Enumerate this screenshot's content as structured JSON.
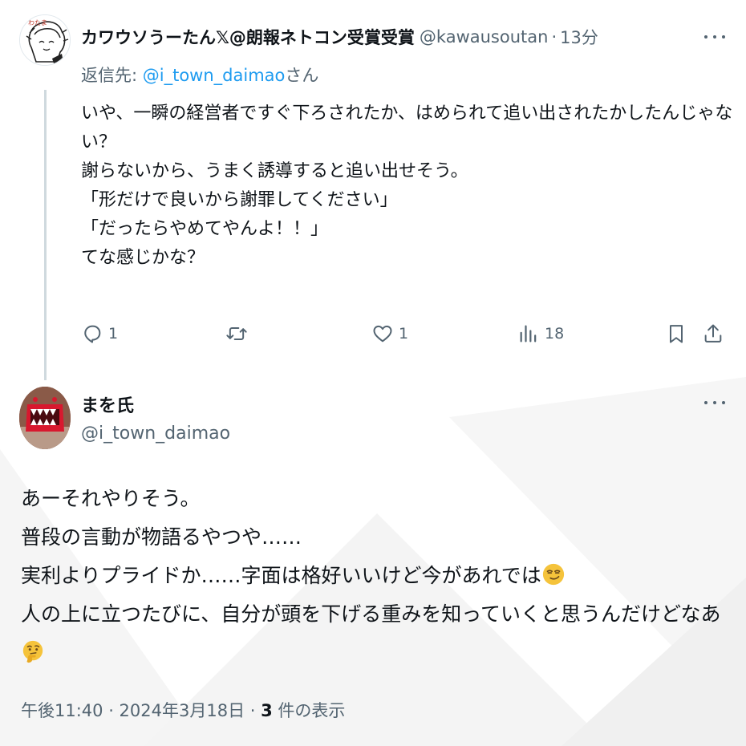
{
  "colors": {
    "text": "#0f1419",
    "secondary": "#536471",
    "link": "#1d9bf0",
    "thread_line": "#cfd9de"
  },
  "parent_tweet": {
    "avatar_icon": "cartoon-avatar",
    "display_name": "カワウソうーたん𝕏@朗報ネトコン受賞受賞",
    "handle": "@kawausoutan",
    "separator": "·",
    "time": "13分",
    "reply_prefix": "返信先: ",
    "reply_mention": "@i_town_daimao",
    "reply_suffix": "さん",
    "body_lines": [
      "いや、一瞬の経営者ですぐ下ろされたか、はめられて追い出されたかしたんじゃな",
      "い？",
      "謝らないから、うまく誘導すると追い出せそう。",
      "「形だけで良いから謝罪してください」",
      "「だったらやめてやんよ！！」",
      "てな感じかな？"
    ],
    "actions": {
      "reply_count": "1",
      "retweet_count": "",
      "like_count": "1",
      "views_count": "18"
    }
  },
  "main_tweet": {
    "avatar_icon": "red-monster-avatar",
    "display_name": "まを氏",
    "handle": "@i_town_daimao",
    "body_lines": [
      "あーそれやりそう。",
      "普段の言動が物語るやつや……",
      "実利よりプライドか……字面は格好いいけど今があれでは",
      "人の上に立つたびに、自分が頭を下げる重みを知っていくと思うんだけどなあ"
    ],
    "emojis": [
      "smirking-face",
      "thinking-face"
    ],
    "timestamp": "午後11:40 · 2024年3月18日 · ",
    "view_count": "3",
    "view_label": " 件の表示"
  }
}
